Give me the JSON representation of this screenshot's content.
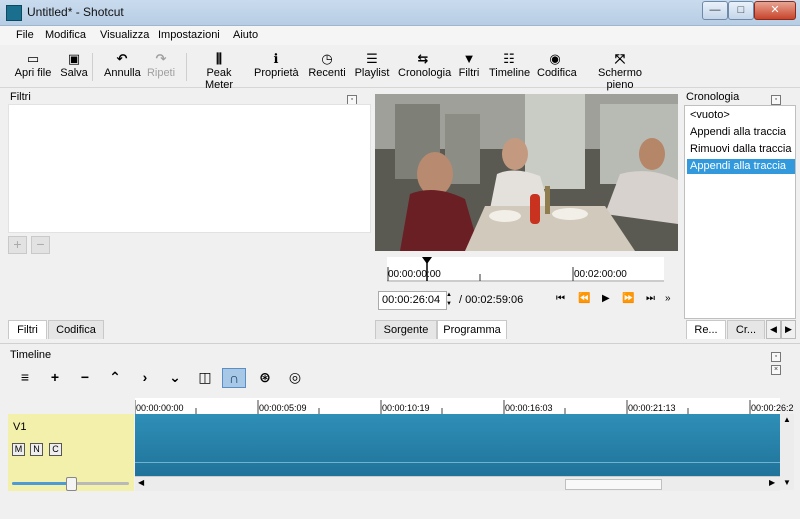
{
  "window": {
    "title": "Untitled* - Shotcut",
    "minimize": "—",
    "maximize": "□",
    "close": "✕"
  },
  "menu": [
    "File",
    "Modifica",
    "Visualizza",
    "Impostazioni",
    "Aiuto"
  ],
  "toolbar": [
    {
      "label": "Apri file",
      "icon": "folder-icon",
      "glyph": "▭"
    },
    {
      "label": "Salva",
      "icon": "save-icon",
      "glyph": "▣"
    },
    {
      "label": "Annulla",
      "icon": "undo-icon",
      "glyph": "↶"
    },
    {
      "label": "Ripeti",
      "icon": "redo-icon",
      "glyph": "↷",
      "disabled": true
    },
    {
      "label": "Peak Meter",
      "icon": "peak-meter-icon",
      "glyph": "⫼"
    },
    {
      "label": "Proprietà",
      "icon": "info-icon",
      "glyph": "ℹ"
    },
    {
      "label": "Recenti",
      "icon": "clock-icon",
      "glyph": "◷"
    },
    {
      "label": "Playlist",
      "icon": "playlist-icon",
      "glyph": "☰"
    },
    {
      "label": "Cronologia",
      "icon": "history-icon",
      "glyph": "⇆"
    },
    {
      "label": "Filtri",
      "icon": "filter-icon",
      "glyph": "▼"
    },
    {
      "label": "Timeline",
      "icon": "timeline-icon",
      "glyph": "☷"
    },
    {
      "label": "Codifica",
      "icon": "encode-icon",
      "glyph": "◉"
    },
    {
      "label": "Schermo pieno",
      "icon": "fullscreen-icon",
      "glyph": "⤧"
    }
  ],
  "filters": {
    "title": "Filtri",
    "add": "+",
    "remove": "−",
    "tabs": [
      "Filtri",
      "Codifica"
    ]
  },
  "player": {
    "ruler_labels": [
      "00:00:00:00",
      "00:02:00:00"
    ],
    "position": "00:00:26:04",
    "duration": "/ 00:02:59:06",
    "controls": [
      "⏮",
      "⏪",
      "▶",
      "⏩",
      "⏭",
      "»"
    ],
    "tabs": [
      "Sorgente",
      "Programma"
    ]
  },
  "history": {
    "title": "Cronologia",
    "items": [
      "<vuoto>",
      "Appendi alla traccia",
      "Rimuovi dalla traccia",
      "Appendi alla traccia"
    ],
    "selected_index": 3,
    "tabs": [
      "Re...",
      "Cr..."
    ],
    "nav": [
      "◀",
      "▶"
    ]
  },
  "timeline": {
    "title": "Timeline",
    "tools": [
      {
        "icon": "menu-icon",
        "glyph": "≡"
      },
      {
        "icon": "append-icon",
        "glyph": "+"
      },
      {
        "icon": "remove-icon",
        "glyph": "−"
      },
      {
        "icon": "lift-icon",
        "glyph": "⌃"
      },
      {
        "icon": "overwrite-icon",
        "glyph": "›"
      },
      {
        "icon": "ripple-icon",
        "glyph": "⌄"
      },
      {
        "icon": "split-icon",
        "glyph": "◫"
      },
      {
        "icon": "snap-icon",
        "glyph": "∩",
        "active": true
      },
      {
        "icon": "scrub-icon",
        "glyph": "⊛"
      },
      {
        "icon": "ripple-all-icon",
        "glyph": "◎"
      }
    ],
    "ruler_labels": [
      "00:00:00:00",
      "00:00:05:09",
      "00:00:10:19",
      "00:00:16:03",
      "00:00:21:13",
      "00:00:26:2"
    ],
    "track": {
      "name": "V1",
      "buttons": [
        "M",
        "N",
        "C"
      ]
    },
    "zoom": 0.5
  },
  "colors": {
    "accent": "#3399dd",
    "clip": "#2a86ae",
    "track_head": "#f3f0ab"
  }
}
